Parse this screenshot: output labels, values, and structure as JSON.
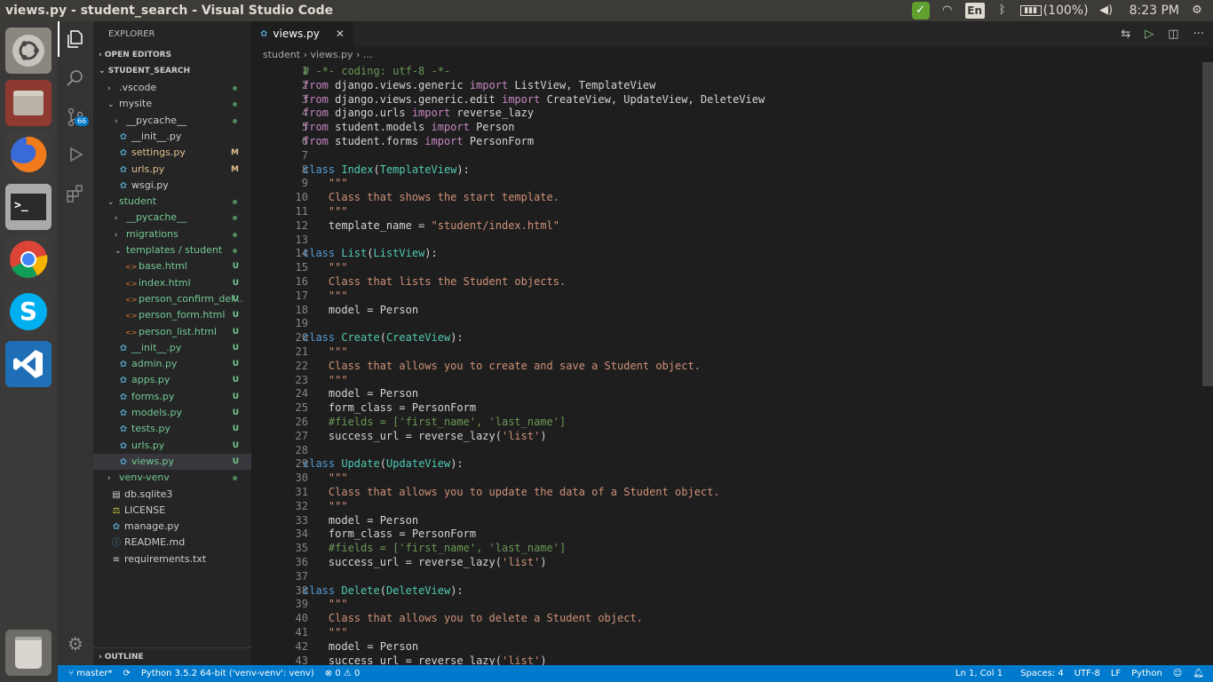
{
  "window_title": "views.py - student_search - Visual Studio Code",
  "tray": {
    "lang": "En",
    "battery": "(100%)",
    "time": "8:23 PM"
  },
  "launcher": [
    {
      "name": "ubuntu-dash-icon"
    },
    {
      "name": "files-icon"
    },
    {
      "name": "firefox-icon"
    },
    {
      "name": "terminal-icon"
    },
    {
      "name": "chrome-icon"
    },
    {
      "name": "skype-icon"
    },
    {
      "name": "vscode-icon"
    },
    {
      "name": "trash-icon"
    }
  ],
  "activity": {
    "scm_badge": "66"
  },
  "sidebar": {
    "header": "EXPLORER",
    "open_editors": "OPEN EDITORS",
    "project": "STUDENT_SEARCH",
    "outline": "OUTLINE",
    "tree": [
      {
        "label": ".vscode",
        "indent": 1,
        "arrow": "›",
        "color": "#cccccc",
        "status": "dot"
      },
      {
        "label": "mysite",
        "indent": 1,
        "arrow": "⌄",
        "color": "#cccccc",
        "status": "dot"
      },
      {
        "label": "__pycache__",
        "indent": 2,
        "arrow": "›",
        "color": "#cccccc",
        "status": "dot"
      },
      {
        "label": "__init__.py",
        "indent": 2,
        "icon": "py",
        "color": "#cccccc",
        "status": ""
      },
      {
        "label": "settings.py",
        "indent": 2,
        "icon": "py",
        "color": "#e2c08d",
        "status": "M"
      },
      {
        "label": "urls.py",
        "indent": 2,
        "icon": "py",
        "color": "#e2c08d",
        "status": "M"
      },
      {
        "label": "wsgi.py",
        "indent": 2,
        "icon": "py",
        "color": "#cccccc",
        "status": ""
      },
      {
        "label": "student",
        "indent": 1,
        "arrow": "⌄",
        "color": "#73c991",
        "status": "dot"
      },
      {
        "label": "__pycache__",
        "indent": 2,
        "arrow": "›",
        "color": "#73c991",
        "status": "dot"
      },
      {
        "label": "migrations",
        "indent": 2,
        "arrow": "›",
        "color": "#73c991",
        "status": "dot"
      },
      {
        "label": "templates / student",
        "indent": 2,
        "arrow": "⌄",
        "color": "#73c991",
        "status": "dot"
      },
      {
        "label": "base.html",
        "indent": 3,
        "icon": "html",
        "color": "#73c991",
        "status": "U"
      },
      {
        "label": "index.html",
        "indent": 3,
        "icon": "html",
        "color": "#73c991",
        "status": "U"
      },
      {
        "label": "person_confirm_del...",
        "indent": 3,
        "icon": "html",
        "color": "#73c991",
        "status": "U"
      },
      {
        "label": "person_form.html",
        "indent": 3,
        "icon": "html",
        "color": "#73c991",
        "status": "U"
      },
      {
        "label": "person_list.html",
        "indent": 3,
        "icon": "html",
        "color": "#73c991",
        "status": "U"
      },
      {
        "label": "__init__.py",
        "indent": 2,
        "icon": "py",
        "color": "#73c991",
        "status": "U"
      },
      {
        "label": "admin.py",
        "indent": 2,
        "icon": "py",
        "color": "#73c991",
        "status": "U"
      },
      {
        "label": "apps.py",
        "indent": 2,
        "icon": "py",
        "color": "#73c991",
        "status": "U"
      },
      {
        "label": "forms.py",
        "indent": 2,
        "icon": "py",
        "color": "#73c991",
        "status": "U"
      },
      {
        "label": "models.py",
        "indent": 2,
        "icon": "py",
        "color": "#73c991",
        "status": "U"
      },
      {
        "label": "tests.py",
        "indent": 2,
        "icon": "py",
        "color": "#73c991",
        "status": "U"
      },
      {
        "label": "urls.py",
        "indent": 2,
        "icon": "py",
        "color": "#73c991",
        "status": "U"
      },
      {
        "label": "views.py",
        "indent": 2,
        "icon": "py",
        "color": "#73c991",
        "status": "U",
        "selected": true
      },
      {
        "label": "venv-venv",
        "indent": 1,
        "arrow": "›",
        "color": "#73c991",
        "status": "dot"
      },
      {
        "label": "db.sqlite3",
        "indent": 1,
        "icon": "db",
        "color": "#cccccc",
        "status": ""
      },
      {
        "label": "LICENSE",
        "indent": 1,
        "icon": "lic",
        "color": "#cccccc",
        "status": ""
      },
      {
        "label": "manage.py",
        "indent": 1,
        "icon": "py",
        "color": "#cccccc",
        "status": ""
      },
      {
        "label": "README.md",
        "indent": 1,
        "icon": "info",
        "color": "#cccccc",
        "status": ""
      },
      {
        "label": "requirements.txt",
        "indent": 1,
        "icon": "txt",
        "color": "#cccccc",
        "status": ""
      }
    ]
  },
  "editor": {
    "tab_label": "views.py",
    "breadcrumb": "student  ›  views.py  ›  ...",
    "lines": [
      [
        [
          "# -*- coding: utf-8 -*-",
          "cmt"
        ]
      ],
      [
        [
          "from",
          "kw2"
        ],
        [
          " django.views.generic ",
          ""
        ],
        [
          "import",
          "kw2"
        ],
        [
          " ListView, TemplateView",
          ""
        ]
      ],
      [
        [
          "from",
          "kw2"
        ],
        [
          " django.views.generic.edit ",
          ""
        ],
        [
          "import",
          "kw2"
        ],
        [
          " CreateView, UpdateView, DeleteView",
          ""
        ]
      ],
      [
        [
          "from",
          "kw2"
        ],
        [
          " django.urls ",
          ""
        ],
        [
          "import",
          "kw2"
        ],
        [
          " reverse_lazy",
          ""
        ]
      ],
      [
        [
          "from",
          "kw2"
        ],
        [
          " student.models ",
          ""
        ],
        [
          "import",
          "kw2"
        ],
        [
          " Person",
          ""
        ]
      ],
      [
        [
          "from",
          "kw2"
        ],
        [
          " student.forms ",
          ""
        ],
        [
          "import",
          "kw2"
        ],
        [
          " PersonForm",
          ""
        ]
      ],
      [],
      [
        [
          "class",
          "kw"
        ],
        [
          " ",
          ""
        ],
        [
          "Index",
          "cls"
        ],
        [
          "(",
          ""
        ],
        [
          "TemplateView",
          "cls"
        ],
        [
          "):",
          ""
        ]
      ],
      [
        [
          "    \"\"\"",
          "str"
        ]
      ],
      [
        [
          "    Class that shows the start template.",
          "str"
        ]
      ],
      [
        [
          "    \"\"\"",
          "str"
        ]
      ],
      [
        [
          "    template_name = ",
          ""
        ],
        [
          "\"student/index.html\"",
          "str"
        ]
      ],
      [],
      [
        [
          "class",
          "kw"
        ],
        [
          " ",
          ""
        ],
        [
          "List",
          "cls"
        ],
        [
          "(",
          ""
        ],
        [
          "ListView",
          "cls"
        ],
        [
          "):",
          ""
        ]
      ],
      [
        [
          "    \"\"\"",
          "str"
        ]
      ],
      [
        [
          "    Class that lists the Student objects.",
          "str"
        ]
      ],
      [
        [
          "    \"\"\"",
          "str"
        ]
      ],
      [
        [
          "    model = Person",
          ""
        ]
      ],
      [],
      [
        [
          "class",
          "kw"
        ],
        [
          " ",
          ""
        ],
        [
          "Create",
          "cls"
        ],
        [
          "(",
          ""
        ],
        [
          "CreateView",
          "cls"
        ],
        [
          "):",
          ""
        ]
      ],
      [
        [
          "    \"\"\"",
          "str"
        ]
      ],
      [
        [
          "    Class that allows you to create and save a Student object.",
          "str"
        ]
      ],
      [
        [
          "    \"\"\"",
          "str"
        ]
      ],
      [
        [
          "    model = Person",
          ""
        ]
      ],
      [
        [
          "    form_class = PersonForm",
          ""
        ]
      ],
      [
        [
          "    #fields = ['first_name', 'last_name']",
          "cmt"
        ]
      ],
      [
        [
          "    success_url = reverse_lazy(",
          ""
        ],
        [
          "'list'",
          "str"
        ],
        [
          ")",
          ""
        ]
      ],
      [],
      [
        [
          "class",
          "kw"
        ],
        [
          " ",
          ""
        ],
        [
          "Update",
          "cls"
        ],
        [
          "(",
          ""
        ],
        [
          "UpdateView",
          "cls"
        ],
        [
          "):",
          ""
        ]
      ],
      [
        [
          "    \"\"\"",
          "str"
        ]
      ],
      [
        [
          "    Class that allows you to update the data of a Student object.",
          "str"
        ]
      ],
      [
        [
          "    \"\"\"",
          "str"
        ]
      ],
      [
        [
          "    model = Person",
          ""
        ]
      ],
      [
        [
          "    form_class = PersonForm",
          ""
        ]
      ],
      [
        [
          "    #fields = ['first_name', 'last_name']",
          "cmt"
        ]
      ],
      [
        [
          "    success_url = reverse_lazy(",
          ""
        ],
        [
          "'list'",
          "str"
        ],
        [
          ")",
          ""
        ]
      ],
      [],
      [
        [
          "class",
          "kw"
        ],
        [
          " ",
          ""
        ],
        [
          "Delete",
          "cls"
        ],
        [
          "(",
          ""
        ],
        [
          "DeleteView",
          "cls"
        ],
        [
          "):",
          ""
        ]
      ],
      [
        [
          "    \"\"\"",
          "str"
        ]
      ],
      [
        [
          "    Class that allows you to delete a Student object.",
          "str"
        ]
      ],
      [
        [
          "    \"\"\"",
          "str"
        ]
      ],
      [
        [
          "    model = Person",
          ""
        ]
      ],
      [
        [
          "    success_url = reverse_lazy(",
          ""
        ],
        [
          "'list'",
          "str"
        ],
        [
          ")",
          ""
        ]
      ]
    ]
  },
  "status": {
    "branch": "master*",
    "sync": "⟳",
    "python": "Python 3.5.2 64-bit ('venv-venv': venv)",
    "problems": "⊗ 0 ⚠ 0",
    "position": "Ln 1, Col 1",
    "spaces": "Spaces: 4",
    "encoding": "UTF-8",
    "eol": "LF",
    "language": "Python"
  }
}
